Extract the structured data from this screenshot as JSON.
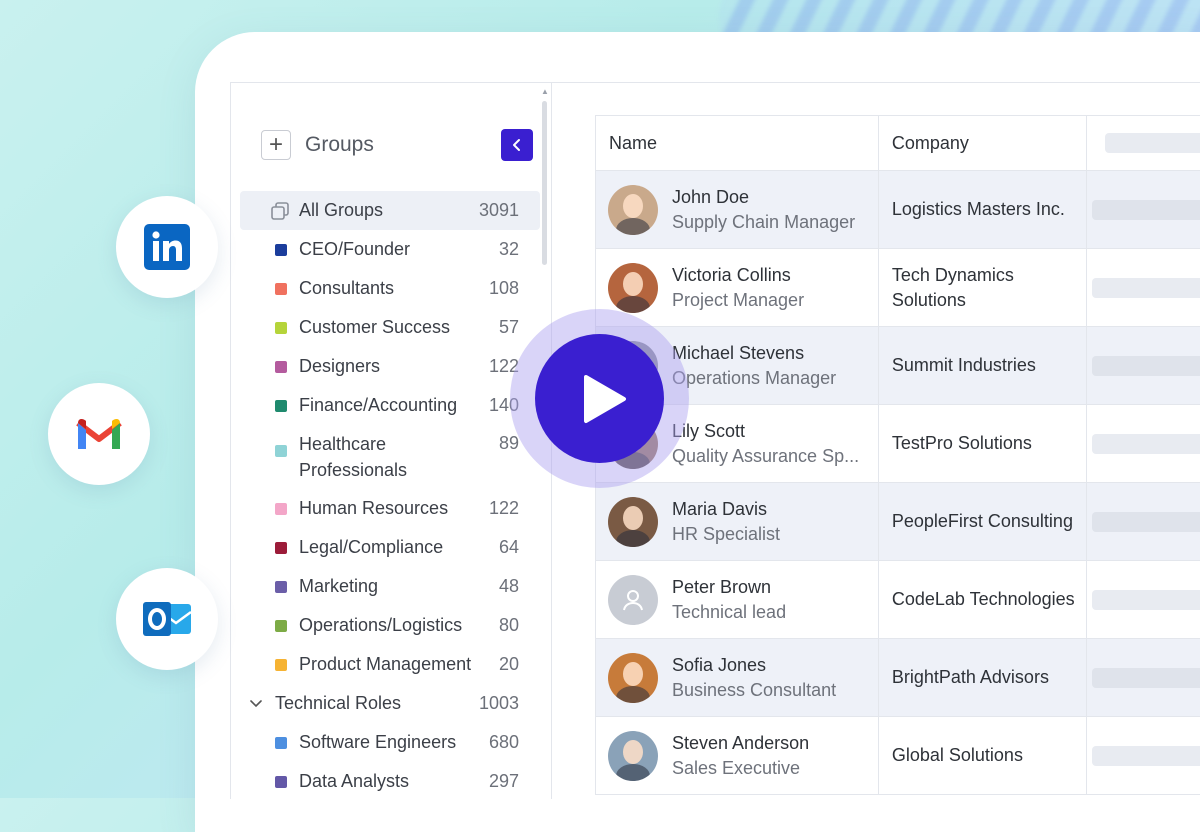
{
  "sidebar": {
    "title": "Groups",
    "all_groups": {
      "label": "All Groups",
      "count": "3091"
    },
    "items": [
      {
        "label": "CEO/Founder",
        "count": "32",
        "color": "#1b3d9c"
      },
      {
        "label": "Consultants",
        "count": "108",
        "color": "#f0715f"
      },
      {
        "label": "Customer Success",
        "count": "57",
        "color": "#b5d43a"
      },
      {
        "label": "Designers",
        "count": "122",
        "color": "#b45b9e"
      },
      {
        "label": "Finance/Accounting",
        "count": "140",
        "color": "#1f8a6e"
      },
      {
        "label": "Healthcare Professionals",
        "count": "89",
        "color": "#8fd3d6"
      },
      {
        "label": "Human Resources",
        "count": "122",
        "color": "#f3a6c8"
      },
      {
        "label": "Legal/Compliance",
        "count": "64",
        "color": "#9c1c39"
      },
      {
        "label": "Marketing",
        "count": "48",
        "color": "#6b5ea8"
      },
      {
        "label": "Operations/Logistics",
        "count": "80",
        "color": "#7dab46"
      },
      {
        "label": "Product Management",
        "count": "20",
        "color": "#f6b333"
      }
    ],
    "technical_roles": {
      "label": "Technical Roles",
      "count": "1003"
    },
    "sub_items": [
      {
        "label": "Software Engineers",
        "count": "680",
        "color": "#4d8fe0"
      },
      {
        "label": "Data Analysts",
        "count": "297",
        "color": "#6358a7"
      }
    ]
  },
  "table": {
    "headers": {
      "name": "Name",
      "company": "Company"
    },
    "rows": [
      {
        "name": "John Doe",
        "title": "Supply Chain Manager",
        "company": "Logistics Masters Inc.",
        "avatar": "#c9a98b"
      },
      {
        "name": "Victoria Collins",
        "title": "Project Manager",
        "company": "Tech Dynamics Solutions",
        "avatar": "#b5653e"
      },
      {
        "name": "Michael Stevens",
        "title": "Operations Manager",
        "company": "Summit Industries",
        "avatar": "#8a8f9e"
      },
      {
        "name": "Lily Scott",
        "title": "Quality Assurance Sp...",
        "company": "TestPro Solutions",
        "avatar": "#9c7a64"
      },
      {
        "name": "Maria Davis",
        "title": "HR Specialist",
        "company": "PeopleFirst Consulting",
        "avatar": "#7a5a44"
      },
      {
        "name": "Peter Brown",
        "title": "Technical lead",
        "company": "CodeLab Technologies",
        "avatar": "#c8ccd4"
      },
      {
        "name": "Sofia Jones",
        "title": "Business Consultant",
        "company": "BrightPath Advisors",
        "avatar": "#c77b3a"
      },
      {
        "name": "Steven Anderson",
        "title": "Sales Executive",
        "company": "Global Solutions",
        "avatar": "#8aa2b8"
      }
    ]
  },
  "integrations": [
    {
      "name": "linkedin-icon",
      "color": "#0a66c2"
    },
    {
      "name": "gmail-icon",
      "color": "#ea4335"
    },
    {
      "name": "outlook-icon",
      "color": "#0f6cbd"
    }
  ],
  "accent": "#3a1fd0"
}
